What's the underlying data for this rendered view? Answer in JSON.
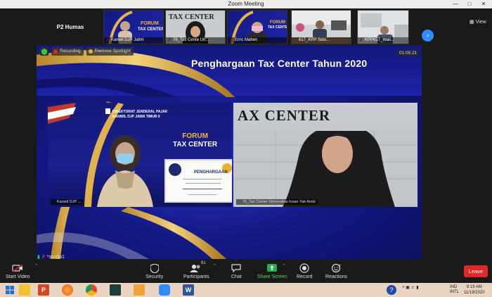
{
  "window": {
    "title": "Zoom Meeting"
  },
  "strip": {
    "host": "P2 Humas",
    "thumbs": [
      {
        "caption": "Kanwil DJP Jatim"
      },
      {
        "caption": "76_Tax Cente Un..."
      },
      {
        "caption": "Erric Mahen"
      },
      {
        "caption": "617_KPP Sido..."
      },
      {
        "caption": "KPP617_Wali..."
      }
    ],
    "view_label": "View"
  },
  "stage": {
    "slide_title": "Penghargaan  Tax Center Tahun 2020",
    "recording": "Recording",
    "remove_spotlight": "Remove Spotlight",
    "timer": "01:05:21",
    "left_video": {
      "org_line1": "DIREKTORAT JENDERAL PAJAK",
      "org_line2": "KANWIL DJP JAWA TIMUR II",
      "forum": "FORUM",
      "tax_center": "TAX CENTER",
      "certificate_title": "PENGHARGAAN",
      "name": "Kanwil DJP ..."
    },
    "right_video": {
      "wall_text": "AX CENTER",
      "name": "76_Tax Center Universitas Insan Yak Ambi"
    },
    "studio": "*studio1"
  },
  "toolbar": {
    "start_video": "Start Video",
    "security": "Security",
    "participants": "Participants",
    "participants_count": "61",
    "chat": "Chat",
    "share_screen": "Share Screen",
    "record": "Record",
    "reactions": "Reactions",
    "leave": "Leave"
  },
  "taskbar": {
    "lang1": "IND",
    "lang2": "INTL",
    "time": "9:19 AM",
    "date": "11/19/2020"
  },
  "colors": {
    "accent_blue": "#2d8cff",
    "leave_red": "#e02828",
    "share_green": "#21b04b",
    "slide_blue": "#141a86",
    "gold": "#f5b731"
  }
}
